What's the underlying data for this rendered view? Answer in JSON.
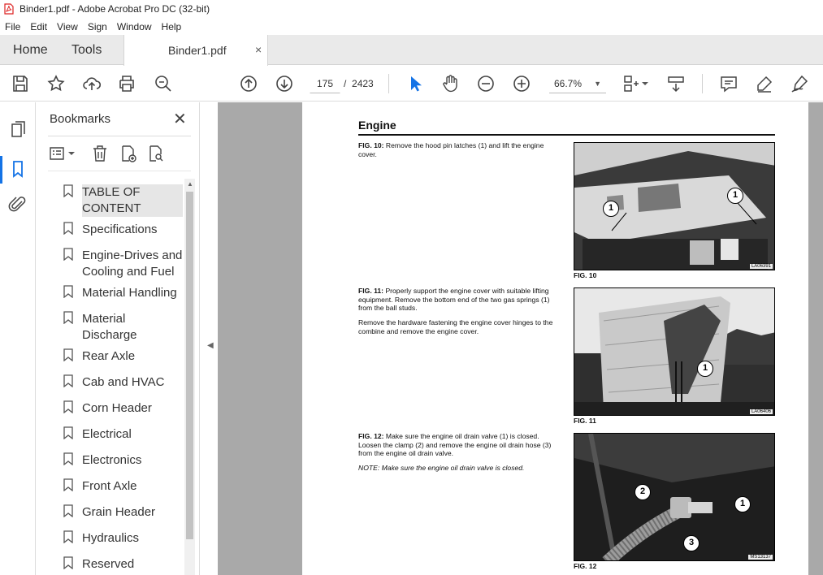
{
  "window": {
    "title": "Binder1.pdf - Adobe Acrobat Pro DC (32-bit)"
  },
  "menu": [
    "File",
    "Edit",
    "View",
    "Sign",
    "Window",
    "Help"
  ],
  "tabs": {
    "home": "Home",
    "tools": "Tools",
    "document": "Binder1.pdf",
    "close_glyph": "×"
  },
  "toolbar": {
    "current_page": "175",
    "page_separator": "/",
    "total_pages": "2423",
    "zoom": "66.7%",
    "icons": [
      "save-icon",
      "bookmark-star-icon",
      "upload-icon",
      "print-icon",
      "search-zoom-icon",
      "page-up-icon",
      "page-down-icon",
      "select-arrow-icon",
      "hand-icon",
      "zoom-out-icon",
      "zoom-in-icon",
      "page-fit-icon",
      "scroll-mode-icon",
      "comment-icon",
      "highlight-icon",
      "sign-icon"
    ]
  },
  "left_rail": {
    "icons": [
      "page-thumbnails-icon",
      "bookmarks-icon",
      "attachments-icon"
    ]
  },
  "bookmarks_panel": {
    "title": "Bookmarks",
    "close_glyph": "✕",
    "items": [
      "TABLE OF CONTENT",
      "Specifications",
      "Engine-Drives and Cooling and Fuel",
      "Material Handling",
      "Material Discharge",
      "Rear Axle",
      "Cab and HVAC",
      "Corn Header",
      "Electrical",
      "Electronics",
      "Front Axle",
      "Grain Header",
      "Hydraulics",
      "Reserved"
    ]
  },
  "page": {
    "heading": "Engine",
    "fig10": {
      "label": "FIG. 10:",
      "text": "Remove the hood pin latches (1) and lift the engine cover.",
      "caption": "FIG. 10",
      "code": "LA06391",
      "callouts": [
        "1",
        "1"
      ]
    },
    "fig11": {
      "label": "FIG. 11:",
      "text": "Properly support the engine cover with suitable lifting equipment. Remove the bottom end of the two gas springs (1) from the ball studs.",
      "text2": "Remove the hardware fastening the engine cover hinges to the combine and remove the engine cover.",
      "caption": "FIG. 11",
      "code": "LA06406",
      "callouts": [
        "1"
      ]
    },
    "fig12": {
      "label": "FIG. 12:",
      "text": "Make sure the engine oil drain valve (1) is closed. Loosen the clamp (2) and remove the engine oil drain hose (3) from the engine oil drain valve.",
      "note": "NOTE: Make sure the engine oil drain valve is closed.",
      "caption": "FIG. 12",
      "code": "MS13137",
      "callouts": [
        "2",
        "1",
        "3"
      ]
    }
  },
  "colors": {
    "accent": "#1473e6",
    "doc_background": "#a9a9a9",
    "tab_bar": "#eaeaea"
  }
}
